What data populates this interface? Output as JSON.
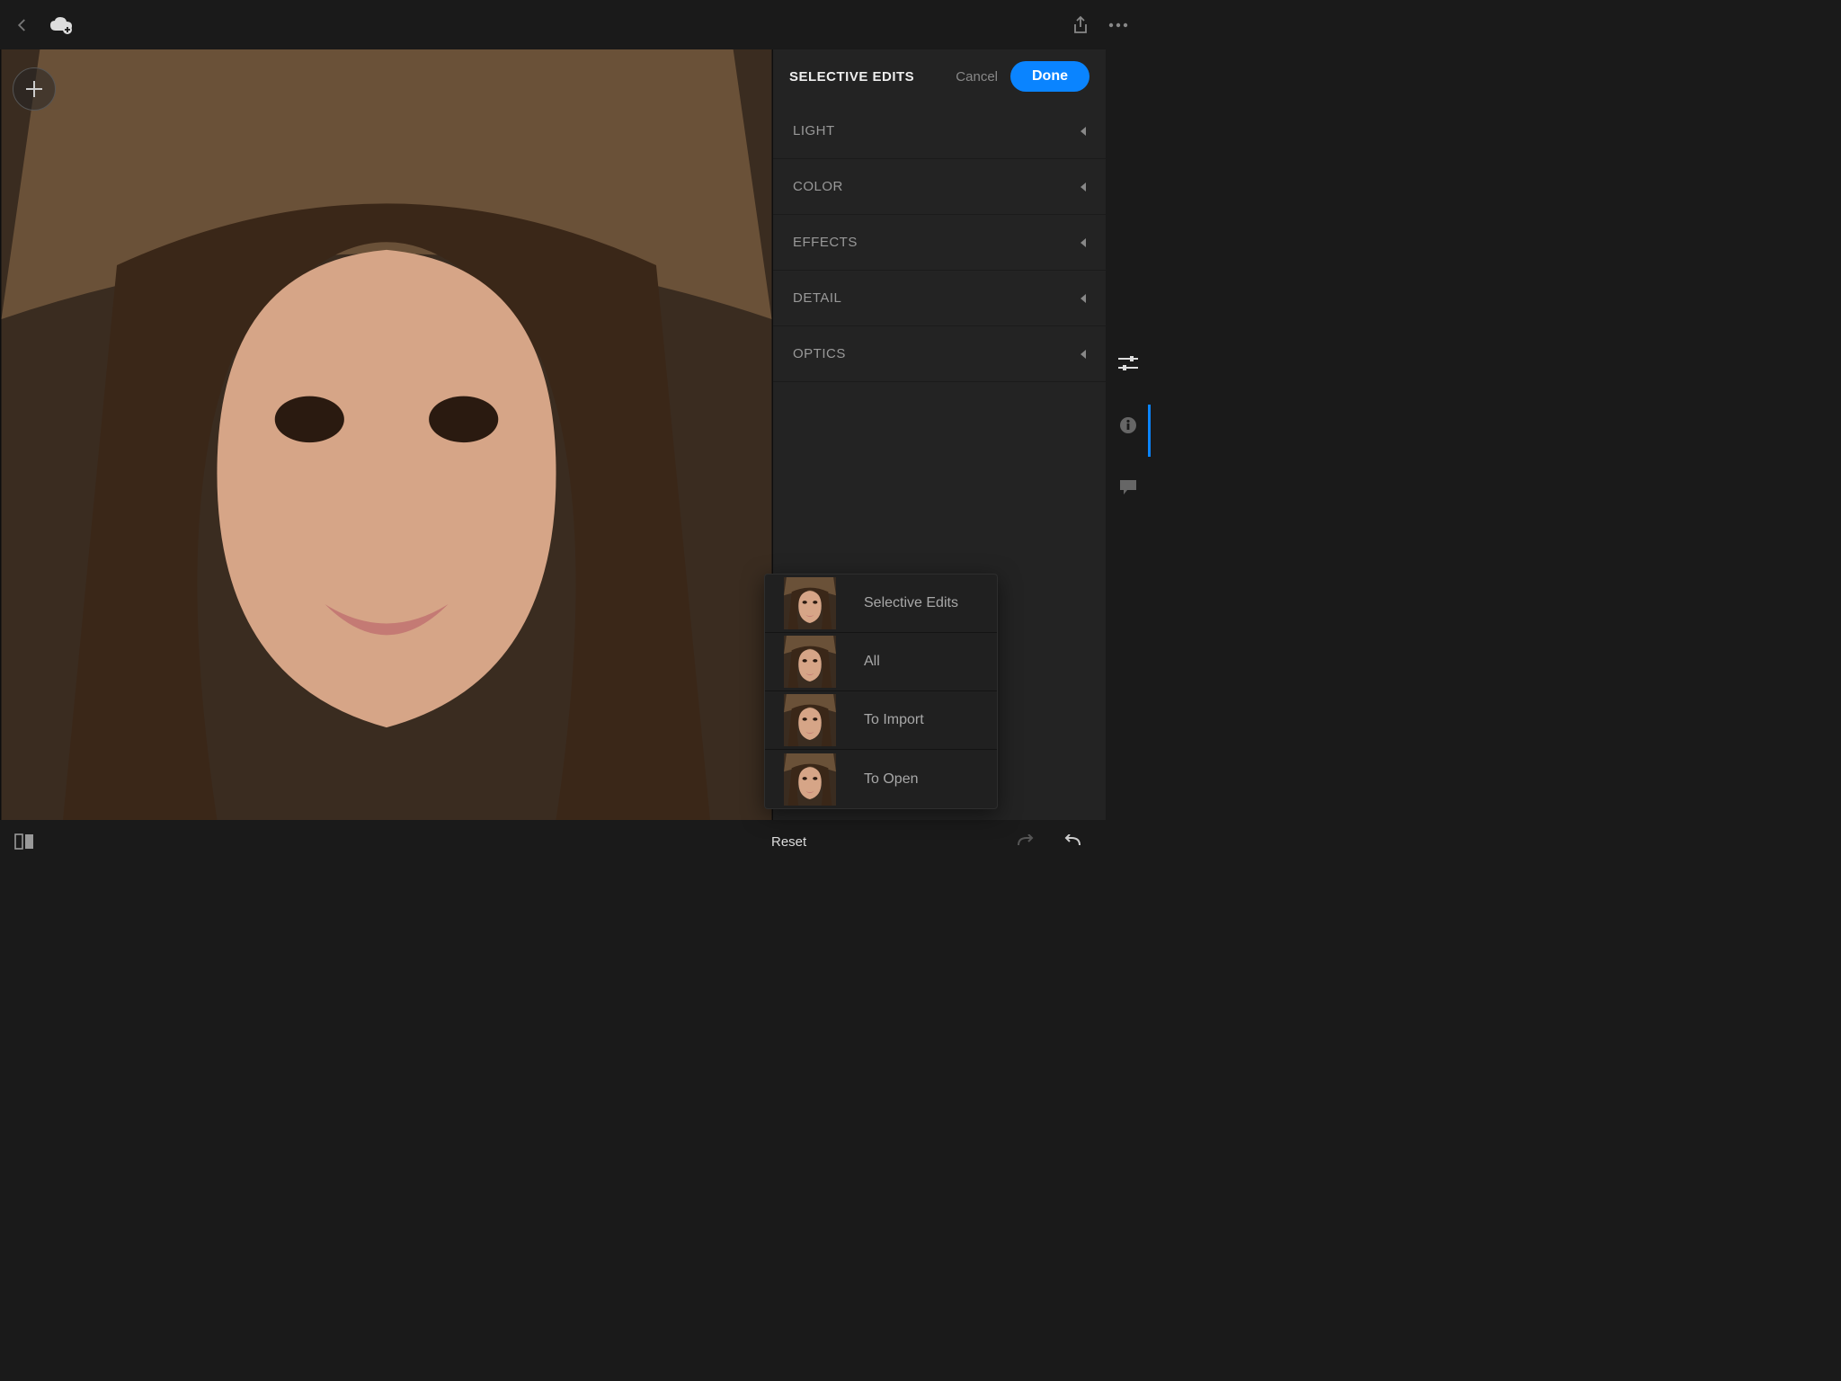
{
  "topbar": {
    "back": "Back",
    "cloud": "Cloud Sync",
    "share": "Share",
    "overflow": "More"
  },
  "canvas": {
    "addSelection": "Add Selection"
  },
  "panel": {
    "title": "SELECTIVE EDITS",
    "cancel": "Cancel",
    "done": "Done",
    "sections": [
      {
        "label": "LIGHT"
      },
      {
        "label": "COLOR"
      },
      {
        "label": "EFFECTS"
      },
      {
        "label": "DETAIL"
      },
      {
        "label": "OPTICS"
      }
    ]
  },
  "rail": {
    "adjust": "Adjust",
    "info": "Info",
    "comments": "Comments"
  },
  "bottom": {
    "compare": "Before/After",
    "reset": "Reset",
    "redo": "Redo",
    "undo": "Undo"
  },
  "popup": {
    "items": [
      {
        "label": "Selective Edits"
      },
      {
        "label": "All"
      },
      {
        "label": "To Import"
      },
      {
        "label": "To Open"
      }
    ]
  }
}
